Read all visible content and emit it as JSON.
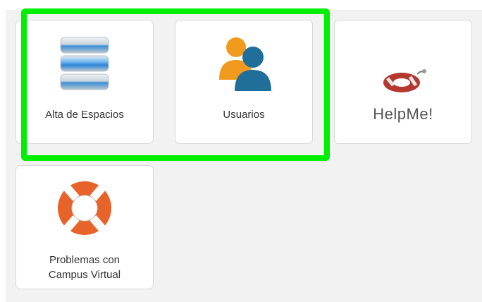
{
  "tiles": {
    "alta": {
      "label": "Alta de Espacios",
      "icon": "server-stack-icon"
    },
    "usuarios": {
      "label": "Usuarios",
      "icon": "users-icon"
    },
    "helpme": {
      "label": "HelpMe!",
      "icon": "lifebuoy-icon"
    },
    "problemas": {
      "label_line1": "Problemas con",
      "label_line2": "Campus Virtual",
      "icon": "lifebuoy-icon"
    }
  },
  "colors": {
    "highlight": "#00ee00",
    "lifebuoy_orange": "#e8632a",
    "lifebuoy_red": "#b5382e",
    "user_orange": "#f29a1d",
    "user_blue": "#1f6f9a"
  }
}
